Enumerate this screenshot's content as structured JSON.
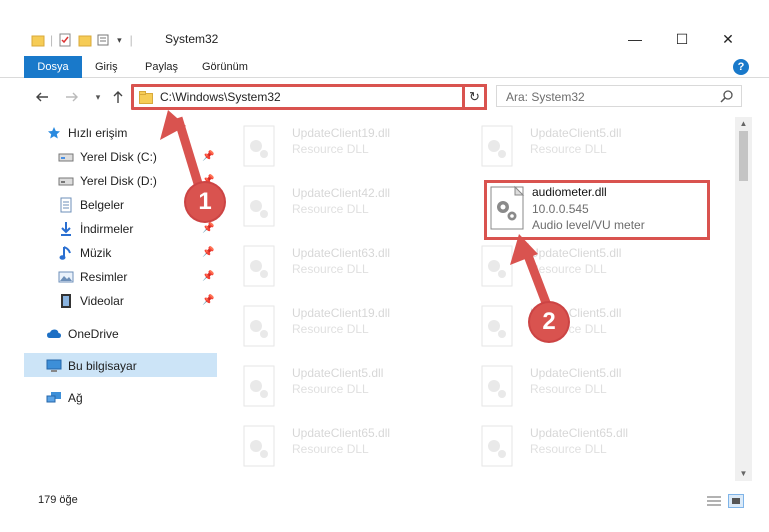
{
  "window": {
    "title": "System32",
    "controls": {
      "minimize": "—",
      "maximize": "☐",
      "close": "✕"
    }
  },
  "ribbon": {
    "tabs": [
      "Dosya",
      "Giriş",
      "Paylaş",
      "Görünüm"
    ],
    "help": "?"
  },
  "address": {
    "path": "C:\\Windows\\System32",
    "search_placeholder": "Ara: System32"
  },
  "sidebar": {
    "quick_access": "Hızlı erişim",
    "items": [
      {
        "label": "Yerel Disk (C:)",
        "icon": "drive-icon",
        "pinned": true
      },
      {
        "label": "Yerel Disk (D:)",
        "icon": "drive-icon",
        "pinned": true
      },
      {
        "label": "Belgeler",
        "icon": "documents-icon",
        "pinned": true
      },
      {
        "label": "İndirmeler",
        "icon": "downloads-icon",
        "pinned": true
      },
      {
        "label": "Müzik",
        "icon": "music-icon",
        "pinned": true
      },
      {
        "label": "Resimler",
        "icon": "pictures-icon",
        "pinned": true
      },
      {
        "label": "Videolar",
        "icon": "videos-icon",
        "pinned": true
      }
    ],
    "onedrive": "OneDrive",
    "this_pc": "Bu bilgisayar",
    "network": "Ağ"
  },
  "files": {
    "left_column": [
      {
        "name": "UpdateClient19.dll",
        "desc": "Resource DLL"
      },
      {
        "name": "UpdateClient42.dll",
        "desc": "Resource DLL"
      },
      {
        "name": "UpdateClient63.dll",
        "desc": "Resource DLL"
      },
      {
        "name": "UpdateClient19.dll",
        "desc": "Resource DLL"
      },
      {
        "name": "UpdateClient5.dll",
        "desc": "Resource DLL"
      },
      {
        "name": "UpdateClient65.dll",
        "desc": "Resource DLL"
      }
    ],
    "right_column": [
      {
        "name": "UpdateClient5.dll",
        "desc": "Resource DLL"
      },
      {
        "name": "UpdateClient5.dll",
        "desc": "Resource DLL"
      },
      {
        "name": "UpdateClient5.dll",
        "desc": "Resource DLL"
      },
      {
        "name": "UpdateClient5.dll",
        "desc": "Resource DLL"
      },
      {
        "name": "UpdateClient65.dll",
        "desc": "Resource DLL"
      }
    ],
    "highlighted": {
      "name": "audiometer.dll",
      "version": "10.0.0.545",
      "desc": "Audio level/VU meter"
    }
  },
  "status": {
    "count": "179 öğe"
  },
  "callouts": {
    "one": "1",
    "two": "2"
  },
  "colors": {
    "accent": "#1979ca",
    "annotation": "#d9534f",
    "selected": "#cce4f7"
  }
}
